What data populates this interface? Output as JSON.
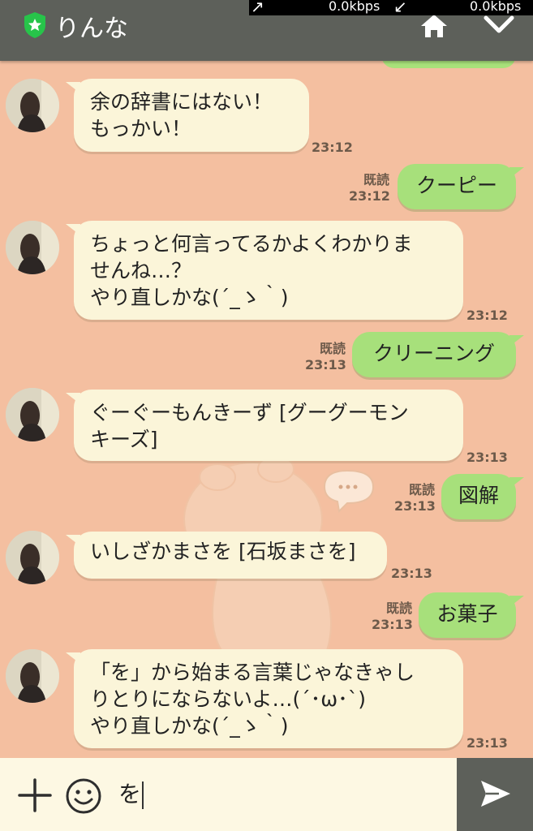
{
  "header": {
    "title": "りんな",
    "shield_icon": "shield-star-icon",
    "home_icon": "home-icon",
    "menu_icon": "chevron-down-icon"
  },
  "netbar": {
    "upload": "0.0kbps",
    "download": "0.0kbps"
  },
  "messages": [
    {
      "side": "in",
      "lines": [
        "余の辞書にはない！",
        "もっかい！"
      ],
      "time": "23:12"
    },
    {
      "side": "out",
      "text": "クーピー",
      "read": "既読",
      "time": "23:12"
    },
    {
      "side": "in",
      "lines": [
        "ちょっと何言ってるかよくわかりま",
        "せんね…？",
        "やり直しかな(´_ゝ｀)"
      ],
      "time": "23:12"
    },
    {
      "side": "out",
      "text": "クリーニング",
      "read": "既読",
      "time": "23:13"
    },
    {
      "side": "in",
      "lines": [
        "ぐーぐーもんきーず [グーグーモン",
        "キーズ]"
      ],
      "time": "23:13"
    },
    {
      "side": "out",
      "text": "図解",
      "read": "既読",
      "time": "23:13"
    },
    {
      "side": "in",
      "lines": [
        "いしざかまさを [石坂まさを]"
      ],
      "time": "23:13"
    },
    {
      "side": "out",
      "text": "お菓子",
      "read": "既読",
      "time": "23:13"
    },
    {
      "side": "in",
      "lines": [
        "「を」から始まる言葉じゃなきゃし",
        "りとりにならないよ…(´･ω･`)",
        "やり直しかな(´_ゝ｀)"
      ],
      "time": "23:13"
    }
  ],
  "input": {
    "value": "を",
    "plus_icon": "plus-icon",
    "emoji_icon": "smiley-icon",
    "send_icon": "send-icon"
  },
  "colors": {
    "background": "#f4bfa0",
    "header": "#5d605a",
    "incoming_bubble": "#fbf5d9",
    "outgoing_bubble": "#a7e07b",
    "read_badge_shield": "#27c44a"
  }
}
